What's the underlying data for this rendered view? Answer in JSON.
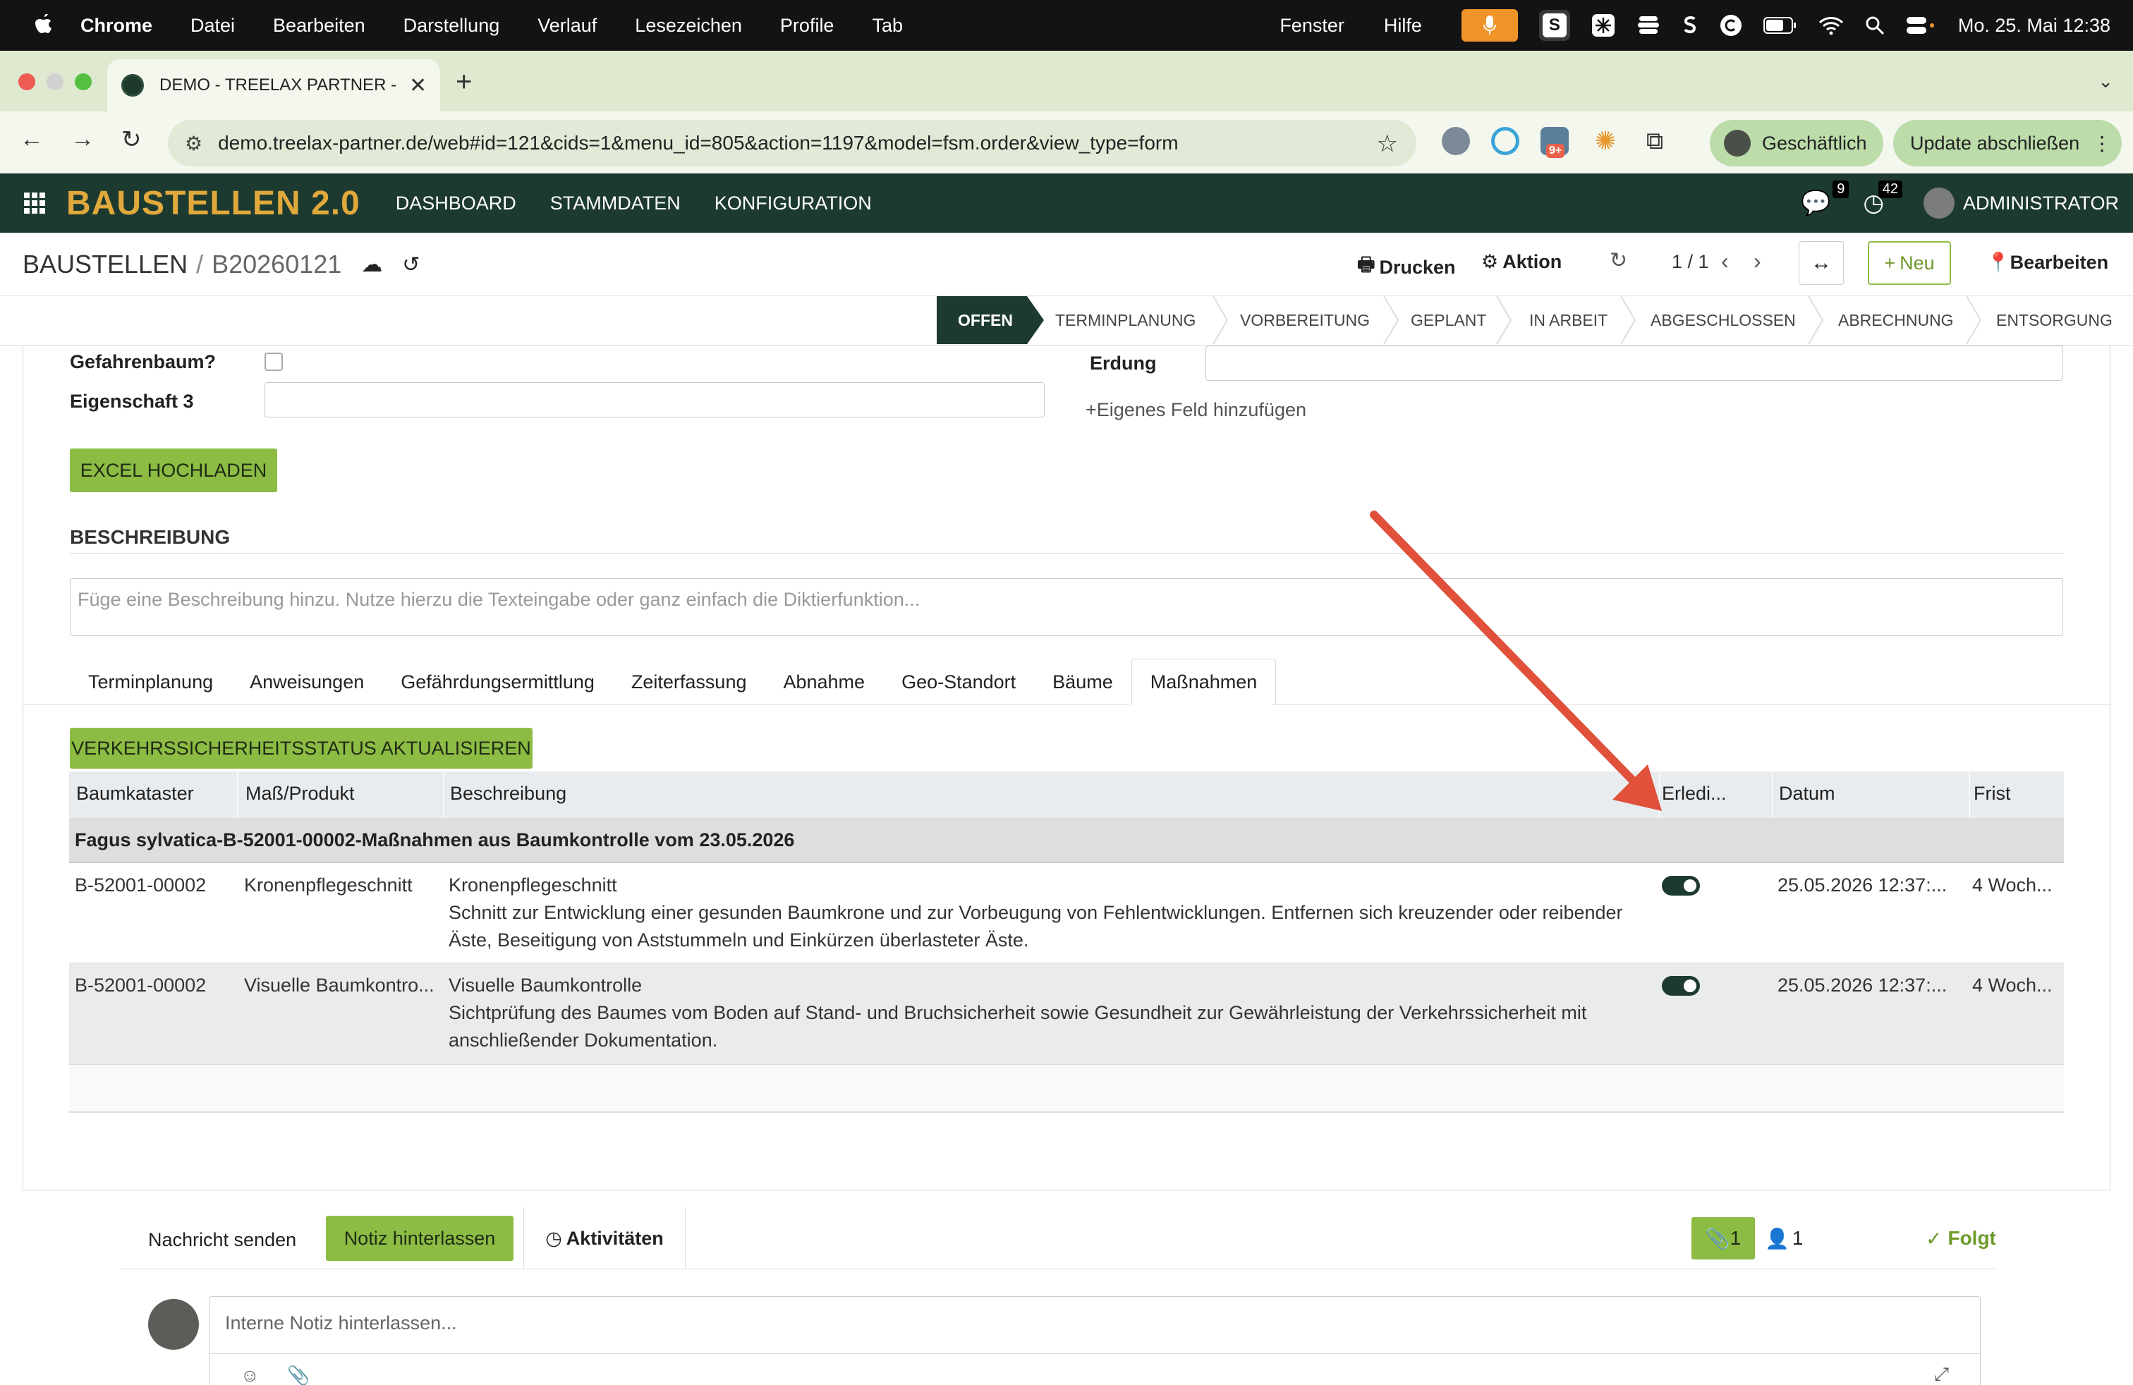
{
  "mac_menu": {
    "app": "Chrome",
    "items": [
      "Datei",
      "Bearbeiten",
      "Darstellung",
      "Verlauf",
      "Lesezeichen",
      "Profile",
      "Tab"
    ],
    "right_items": [
      "Fenster",
      "Hilfe"
    ],
    "s_label": "S",
    "clock": "Mo. 25. Mai  12:38"
  },
  "browser": {
    "tab_title": "DEMO - TREELAX PARTNER - ",
    "url": "demo.treelax-partner.de/web#id=121&cids=1&menu_id=805&action=1197&model=fsm.order&view_type=form",
    "ext_badge": "9+",
    "profile_label": "Geschäftlich",
    "update_label": "Update abschließen"
  },
  "app_nav": {
    "brand": "BAUSTELLEN 2.0",
    "menu": [
      "DASHBOARD",
      "STAMMDATEN",
      "KONFIGURATION"
    ],
    "messages_count": "9",
    "activities_count": "42",
    "user": "ADMINISTRATOR"
  },
  "control": {
    "breadcrumb_parent": "BAUSTELLEN",
    "breadcrumb_separator": "/",
    "breadcrumb_current": "B20260121",
    "print_label": "Drucken",
    "action_label": "Aktion",
    "pager": "1 / 1",
    "new_label": "Neu",
    "edit_label": "Bearbeiten"
  },
  "stages": [
    "OFFEN",
    "TERMINPLANUNG",
    "VORBEREITUNG",
    "GEPLANT",
    "IN ARBEIT",
    "ABGESCHLOSSEN",
    "ABRECHNUNG",
    "ENTSORGUNG"
  ],
  "form": {
    "gefahrenbaum_label": "Gefahrenbaum?",
    "eigenschaft3_label": "Eigenschaft 3",
    "erdung_label": "Erdung",
    "add_field_label": "Eigenes Feld hinzufügen",
    "excel_button": "EXCEL HOCHLADEN",
    "description_title": "BESCHREIBUNG",
    "description_placeholder": "Füge eine Beschreibung hinzu. Nutze hierzu die Texteingabe oder ganz einfach die Diktierfunktion...",
    "tabs": [
      "Terminplanung",
      "Anweisungen",
      "Gefährdungsermittlung",
      "Zeiterfassung",
      "Abnahme",
      "Geo-Standort",
      "Bäume",
      "Maßnahmen"
    ],
    "status_button": "VERKEHRSSICHERHEITSSTATUS AKTUALISIEREN"
  },
  "table": {
    "columns": [
      "Baumkataster",
      "Maß/Produkt",
      "Beschreibung",
      "Erledi...",
      "Datum",
      "Frist"
    ],
    "group": "Fagus sylvatica-B-52001-00002-Maßnahmen aus Baumkontrolle vom 23.05.2026",
    "rows": [
      {
        "kataster": "B-52001-00002",
        "produkt": "Kronenpflegeschnitt",
        "desc_title": "Kronenpflegeschnitt",
        "desc_line1": "Schnitt zur Entwicklung einer gesunden Baumkrone und zur Vorbeugung von Fehlentwicklungen. Entfernen sich kreuzender oder reibender",
        "desc_line2": "Äste, Beseitigung von Aststummeln und Einkürzen überlasteter Äste.",
        "erledigt": true,
        "datum": "25.05.2026 12:37:...",
        "frist": "4 Woch..."
      },
      {
        "kataster": "B-52001-00002",
        "produkt": "Visuelle Baumkontro...",
        "desc_title": "Visuelle Baumkontrolle",
        "desc_line1": "Sichtprüfung des Baumes vom Boden auf Stand- und Bruchsicherheit sowie Gesundheit zur Gewährleistung der Verkehrssicherheit mit",
        "desc_line2": "anschließender Dokumentation.",
        "erledigt": true,
        "datum": "25.05.2026 12:37:...",
        "frist": "4 Woch..."
      }
    ]
  },
  "chatter": {
    "send_label": "Nachricht senden",
    "note_label": "Notiz hinterlassen",
    "activities_label": "Aktivitäten",
    "attachments_count": "1",
    "followers_count": "1",
    "follow_label": "Folgt",
    "composer_placeholder": "Interne Notiz hinterlassen..."
  },
  "colors": {
    "app_nav_bg": "#1d3a30",
    "brand": "#e1a93c",
    "primary_green": "#8cbc44",
    "annotation_arrow": "#e0503a"
  }
}
